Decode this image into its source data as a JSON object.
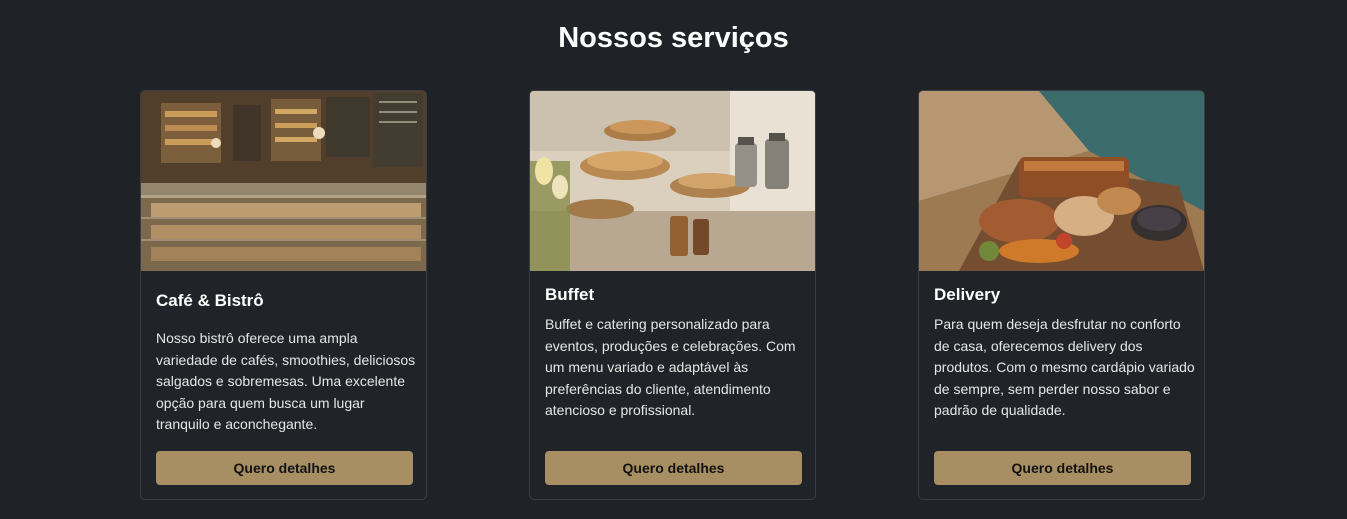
{
  "section": {
    "title": "Nossos serviços"
  },
  "cards": [
    {
      "title": "Café & Bistrô",
      "text": "Nosso bistrô oferece uma ampla variedade de cafés, smoothies, deliciosos salgados e sobremesas. Uma excelente opção para quem busca um lugar tranquilo e aconchegante.",
      "button_label": "Quero detalhes",
      "image": "cafe-interior-photo"
    },
    {
      "title": "Buffet",
      "text": "Buffet e catering personalizado para eventos, produções e celebrações. Com um menu variado e adaptável às preferências do cliente, atendimento atencioso e profissional.",
      "button_label": "Quero detalhes",
      "image": "buffet-table-photo"
    },
    {
      "title": "Delivery",
      "text": "Para quem deseja desfrutar no conforto de casa, oferecemos delivery dos produtos. Com o mesmo cardápio variado de sempre, sem perder nosso sabor e padrão de qualidade.",
      "button_label": "Quero detalhes",
      "image": "delivery-box-photo"
    }
  ],
  "colors": {
    "background": "#1f2328",
    "card_background": "#202429",
    "card_border": "#3a3f46",
    "button": "#a88f63",
    "button_text": "#111111",
    "title": "#ffffff"
  }
}
